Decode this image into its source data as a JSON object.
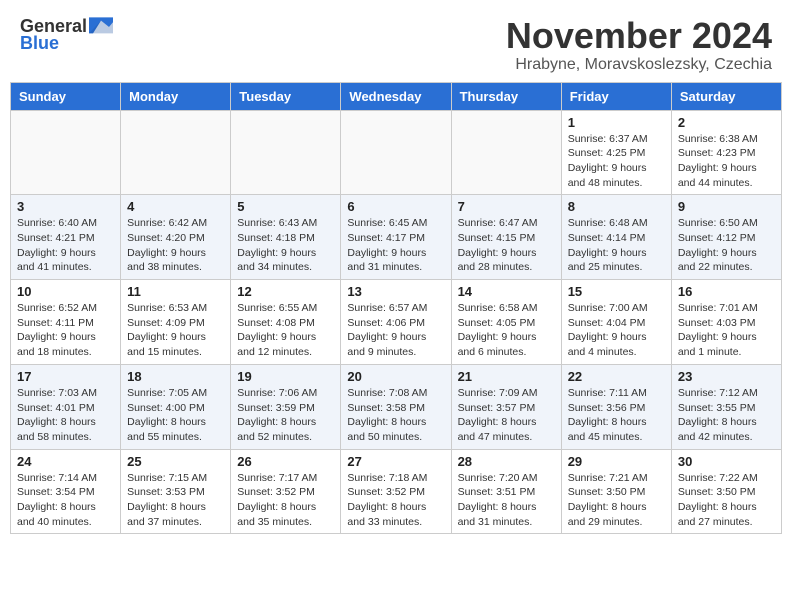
{
  "logo": {
    "general": "General",
    "blue": "Blue"
  },
  "title": {
    "month_year": "November 2024",
    "location": "Hrabyne, Moravskoslezsky, Czechia"
  },
  "days_of_week": [
    "Sunday",
    "Monday",
    "Tuesday",
    "Wednesday",
    "Thursday",
    "Friday",
    "Saturday"
  ],
  "weeks": [
    {
      "days": [
        {
          "num": "",
          "empty": true
        },
        {
          "num": "",
          "empty": true
        },
        {
          "num": "",
          "empty": true
        },
        {
          "num": "",
          "empty": true
        },
        {
          "num": "",
          "empty": true
        },
        {
          "num": "1",
          "info": "Sunrise: 6:37 AM\nSunset: 4:25 PM\nDaylight: 9 hours\nand 48 minutes."
        },
        {
          "num": "2",
          "info": "Sunrise: 6:38 AM\nSunset: 4:23 PM\nDaylight: 9 hours\nand 44 minutes."
        }
      ]
    },
    {
      "days": [
        {
          "num": "3",
          "info": "Sunrise: 6:40 AM\nSunset: 4:21 PM\nDaylight: 9 hours\nand 41 minutes."
        },
        {
          "num": "4",
          "info": "Sunrise: 6:42 AM\nSunset: 4:20 PM\nDaylight: 9 hours\nand 38 minutes."
        },
        {
          "num": "5",
          "info": "Sunrise: 6:43 AM\nSunset: 4:18 PM\nDaylight: 9 hours\nand 34 minutes."
        },
        {
          "num": "6",
          "info": "Sunrise: 6:45 AM\nSunset: 4:17 PM\nDaylight: 9 hours\nand 31 minutes."
        },
        {
          "num": "7",
          "info": "Sunrise: 6:47 AM\nSunset: 4:15 PM\nDaylight: 9 hours\nand 28 minutes."
        },
        {
          "num": "8",
          "info": "Sunrise: 6:48 AM\nSunset: 4:14 PM\nDaylight: 9 hours\nand 25 minutes."
        },
        {
          "num": "9",
          "info": "Sunrise: 6:50 AM\nSunset: 4:12 PM\nDaylight: 9 hours\nand 22 minutes."
        }
      ]
    },
    {
      "days": [
        {
          "num": "10",
          "info": "Sunrise: 6:52 AM\nSunset: 4:11 PM\nDaylight: 9 hours\nand 18 minutes."
        },
        {
          "num": "11",
          "info": "Sunrise: 6:53 AM\nSunset: 4:09 PM\nDaylight: 9 hours\nand 15 minutes."
        },
        {
          "num": "12",
          "info": "Sunrise: 6:55 AM\nSunset: 4:08 PM\nDaylight: 9 hours\nand 12 minutes."
        },
        {
          "num": "13",
          "info": "Sunrise: 6:57 AM\nSunset: 4:06 PM\nDaylight: 9 hours\nand 9 minutes."
        },
        {
          "num": "14",
          "info": "Sunrise: 6:58 AM\nSunset: 4:05 PM\nDaylight: 9 hours\nand 6 minutes."
        },
        {
          "num": "15",
          "info": "Sunrise: 7:00 AM\nSunset: 4:04 PM\nDaylight: 9 hours\nand 4 minutes."
        },
        {
          "num": "16",
          "info": "Sunrise: 7:01 AM\nSunset: 4:03 PM\nDaylight: 9 hours\nand 1 minute."
        }
      ]
    },
    {
      "days": [
        {
          "num": "17",
          "info": "Sunrise: 7:03 AM\nSunset: 4:01 PM\nDaylight: 8 hours\nand 58 minutes."
        },
        {
          "num": "18",
          "info": "Sunrise: 7:05 AM\nSunset: 4:00 PM\nDaylight: 8 hours\nand 55 minutes."
        },
        {
          "num": "19",
          "info": "Sunrise: 7:06 AM\nSunset: 3:59 PM\nDaylight: 8 hours\nand 52 minutes."
        },
        {
          "num": "20",
          "info": "Sunrise: 7:08 AM\nSunset: 3:58 PM\nDaylight: 8 hours\nand 50 minutes."
        },
        {
          "num": "21",
          "info": "Sunrise: 7:09 AM\nSunset: 3:57 PM\nDaylight: 8 hours\nand 47 minutes."
        },
        {
          "num": "22",
          "info": "Sunrise: 7:11 AM\nSunset: 3:56 PM\nDaylight: 8 hours\nand 45 minutes."
        },
        {
          "num": "23",
          "info": "Sunrise: 7:12 AM\nSunset: 3:55 PM\nDaylight: 8 hours\nand 42 minutes."
        }
      ]
    },
    {
      "days": [
        {
          "num": "24",
          "info": "Sunrise: 7:14 AM\nSunset: 3:54 PM\nDaylight: 8 hours\nand 40 minutes."
        },
        {
          "num": "25",
          "info": "Sunrise: 7:15 AM\nSunset: 3:53 PM\nDaylight: 8 hours\nand 37 minutes."
        },
        {
          "num": "26",
          "info": "Sunrise: 7:17 AM\nSunset: 3:52 PM\nDaylight: 8 hours\nand 35 minutes."
        },
        {
          "num": "27",
          "info": "Sunrise: 7:18 AM\nSunset: 3:52 PM\nDaylight: 8 hours\nand 33 minutes."
        },
        {
          "num": "28",
          "info": "Sunrise: 7:20 AM\nSunset: 3:51 PM\nDaylight: 8 hours\nand 31 minutes."
        },
        {
          "num": "29",
          "info": "Sunrise: 7:21 AM\nSunset: 3:50 PM\nDaylight: 8 hours\nand 29 minutes."
        },
        {
          "num": "30",
          "info": "Sunrise: 7:22 AM\nSunset: 3:50 PM\nDaylight: 8 hours\nand 27 minutes."
        }
      ]
    }
  ]
}
